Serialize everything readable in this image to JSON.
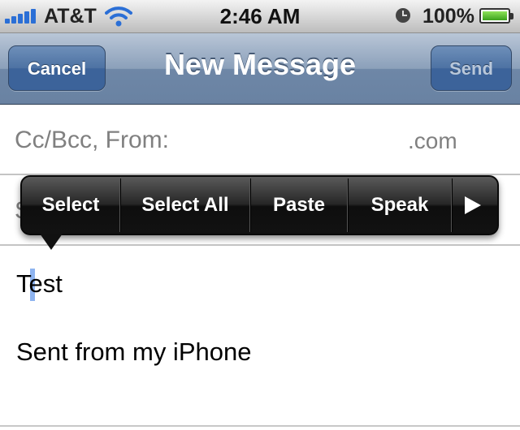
{
  "status_bar": {
    "carrier": "AT&T",
    "time": "2:46 AM",
    "battery_percent": "100%",
    "battery_level": 1.0
  },
  "nav": {
    "title": "New Message",
    "cancel_label": "Cancel",
    "send_label": "Send"
  },
  "fields": {
    "cc_bcc_from_label": "Cc/Bcc, From:",
    "from_value": ".com",
    "subject_label": "S"
  },
  "body": {
    "text": "Test",
    "signature": "Sent from my iPhone"
  },
  "edit_menu": {
    "items": [
      "Select",
      "Select All",
      "Paste",
      "Speak"
    ],
    "more_icon": "play-right-arrow-icon"
  }
}
